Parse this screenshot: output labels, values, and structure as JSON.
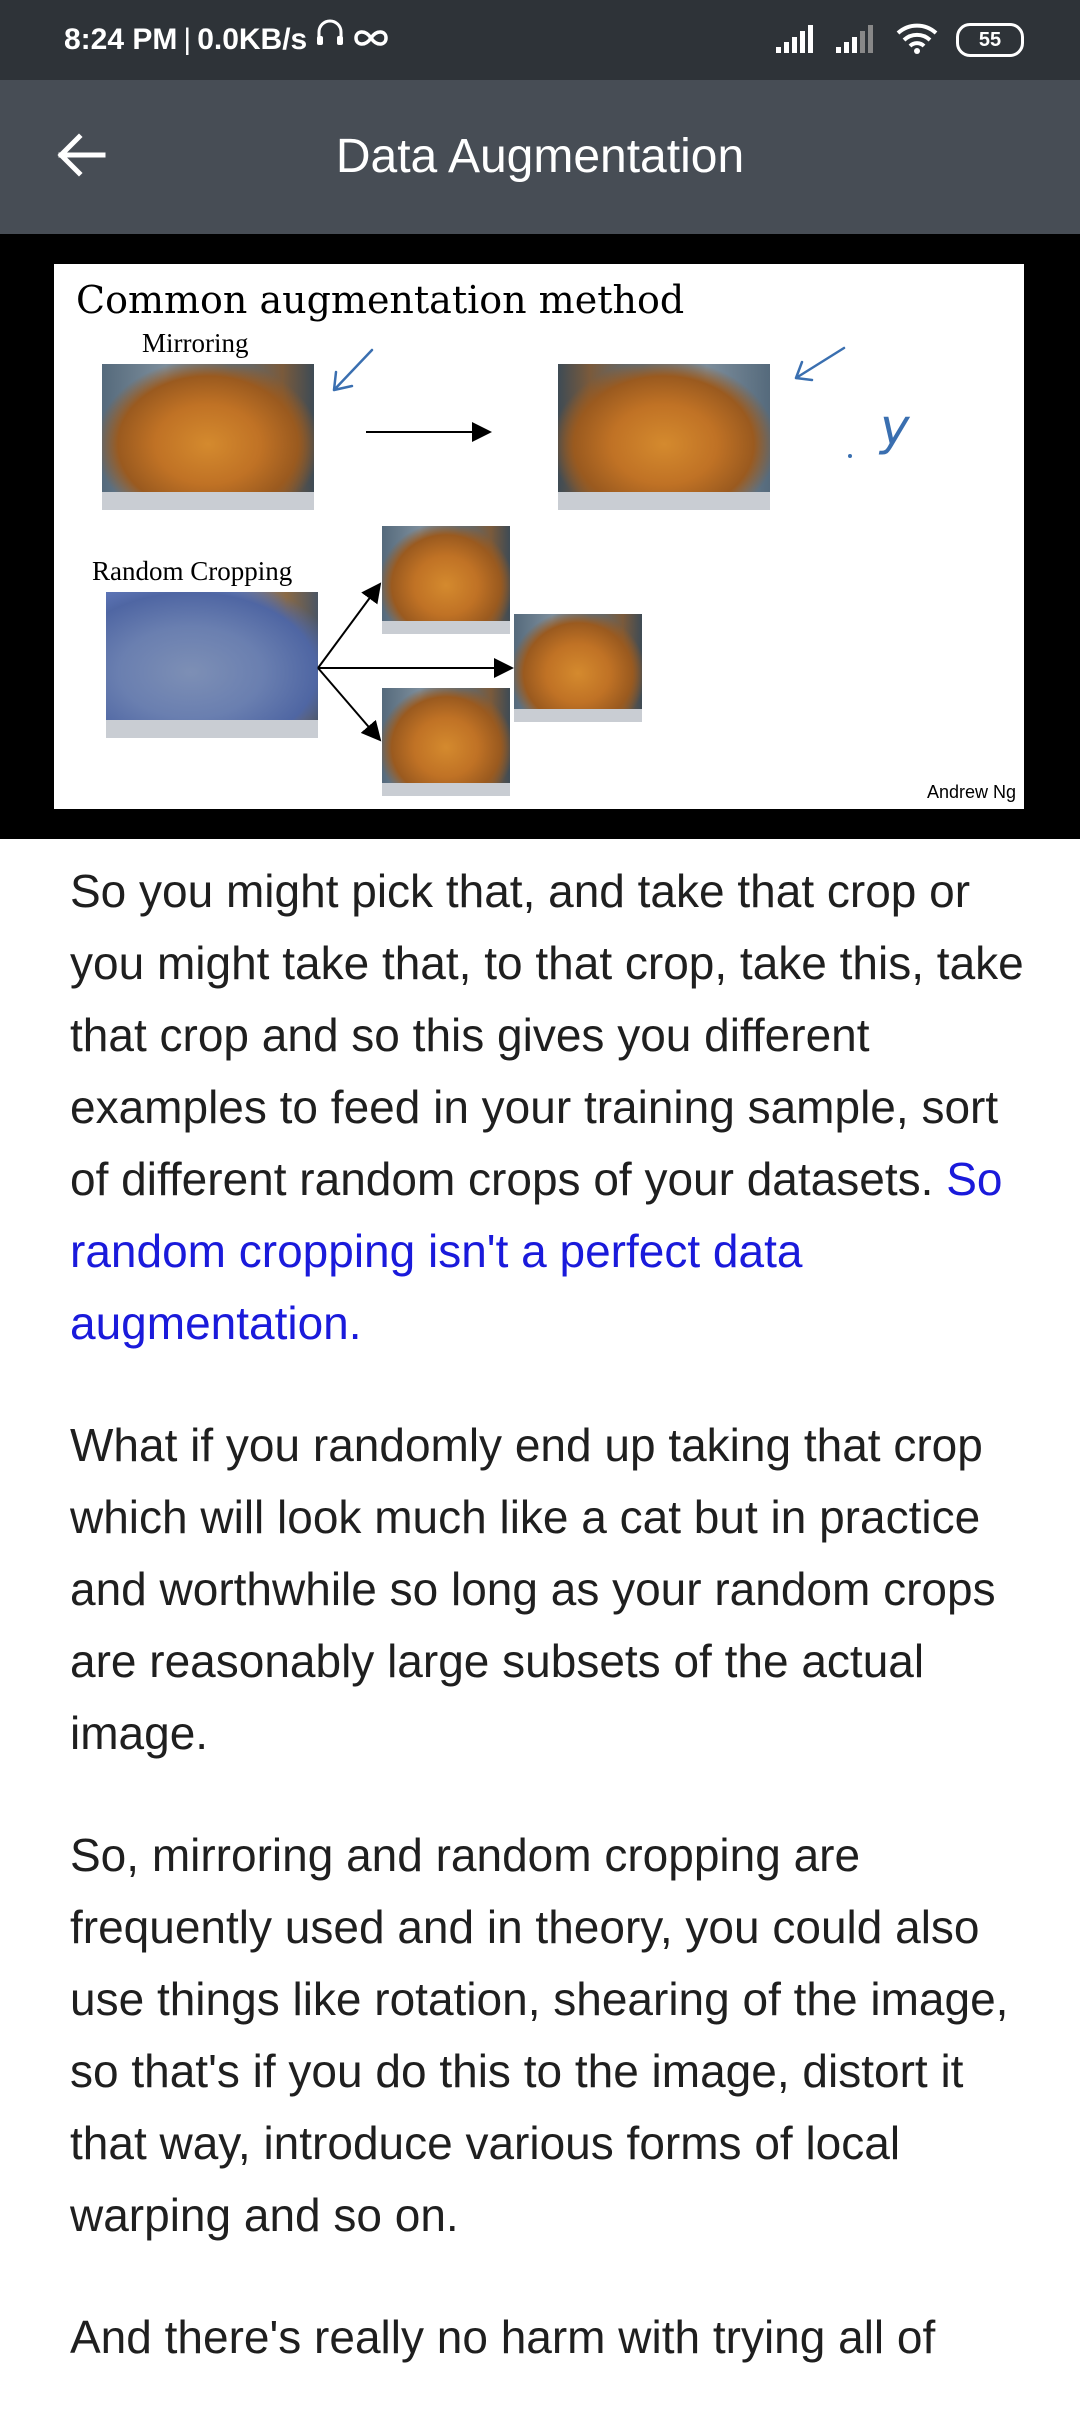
{
  "status_bar": {
    "time": "8:24 PM",
    "separator": "|",
    "network_speed": "0.0KB/s",
    "battery": "55",
    "icons": [
      "headphones-icon",
      "infinity-icon",
      "signal-icon",
      "signal-icon",
      "wifi-icon",
      "battery-icon"
    ]
  },
  "app_bar": {
    "title": "Data Augmentation",
    "back_icon": "arrow-left-icon"
  },
  "slide": {
    "title": "Common augmentation method",
    "mirroring_label": "Mirroring",
    "random_cropping_label": "Random Cropping",
    "handwritten": "y",
    "credit": "Andrew Ng"
  },
  "transcript": {
    "p1_text": "So you might pick that, and take that crop or you might take that, to that crop, take this, take that crop and so this gives you different examples to feed in your training sample, sort of different random crops of your datasets. ",
    "p1_highlight": "So random cropping isn't a perfect data augmentation.",
    "p2": "What if you randomly end up taking that crop which will look much like a cat but in practice and worthwhile so long as your random crops are reasonably large subsets of the actual image.",
    "p3": "So, mirroring and random cropping are frequently used and in theory, you could also use things like rotation, shearing of the image, so that's if you do this to the image, distort it that way, introduce various forms of local warping and so on.",
    "p4_partial": "And there's really no harm with trying all of"
  },
  "colors": {
    "status_bar_bg": "#2e3338",
    "app_bar_bg": "#474d55",
    "highlight": "#1a1adb",
    "text": "#1f1f1f"
  }
}
